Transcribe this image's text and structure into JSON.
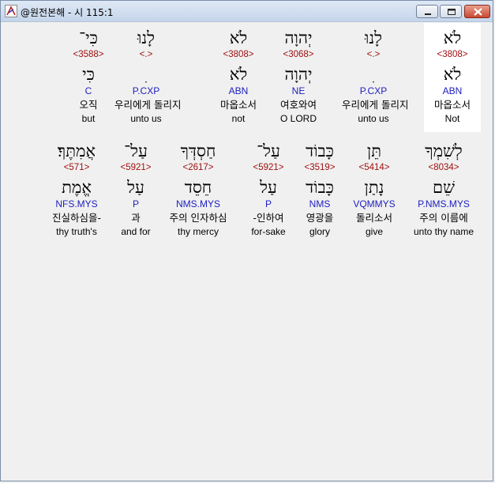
{
  "window": {
    "title": "@원전본해 - 시 115:1"
  },
  "row1": [
    {
      "heb": "לֹא",
      "strong": "<3808>",
      "heb_root": "לֹא",
      "morph": "ABN",
      "kor": "마옵소서",
      "eng": "Not",
      "highlight": true
    },
    {
      "heb": "לָנוּ",
      "strong": "<.>",
      "heb_root": "ִ",
      "morph": "P.CXP",
      "kor": "우리에게 돌리지",
      "eng": "unto us",
      "highlight": false
    },
    {
      "heb": "יְהוָה",
      "strong": "<3068>",
      "heb_root": "יְהוָה",
      "morph": "NE",
      "kor": "여호와여",
      "eng": "O LORD",
      "highlight": false
    },
    {
      "heb": "לֹא",
      "strong": "<3808>",
      "heb_root": "לֹא",
      "morph": "ABN",
      "kor": "마옵소서",
      "eng": "not",
      "highlight": false
    },
    {
      "heb": "לָנוּ",
      "strong": "<.>",
      "heb_root": "ִ",
      "morph": "P.CXP",
      "kor": "우리에게 돌리지",
      "eng": "unto us",
      "highlight": false
    },
    {
      "heb": "כִּי־",
      "strong": "<3588>",
      "heb_root": "כִּי",
      "morph": "C",
      "kor": "오직",
      "eng": "but",
      "highlight": false
    }
  ],
  "row2": [
    {
      "heb": "לְשִׁמְךָ",
      "strong": "<8034>",
      "heb_root": "שֵׁם",
      "morph": "P.NMS.MYS",
      "kor": "주의 이름에",
      "eng": "unto thy name"
    },
    {
      "heb": "תֵּן",
      "strong": "<5414>",
      "heb_root": "נָתַן",
      "morph": "VQMMYS",
      "kor": "돌리소서",
      "eng": "give"
    },
    {
      "heb": "כָּבוֹד",
      "strong": "<3519>",
      "heb_root": "כָּבוֹד",
      "morph": "NMS",
      "kor": "영광을",
      "eng": "glory"
    },
    {
      "heb": "עַל־",
      "strong": "<5921>",
      "heb_root": "עַל",
      "morph": "P",
      "kor": "-인하여",
      "eng": "for-sake"
    },
    {
      "heb": "חַסְדְּךָ",
      "strong": "<2617>",
      "heb_root": "חֵסֵד",
      "morph": "NMS.MYS",
      "kor": "주의 인자하심",
      "eng": "thy mercy"
    },
    {
      "heb": "עַל־",
      "strong": "<5921>",
      "heb_root": "עַל",
      "morph": "P",
      "kor": "과",
      "eng": "and for"
    },
    {
      "heb": "אֲמִתֶּךָ׃",
      "strong": "<571>",
      "heb_root": "אֱמֶת",
      "morph": "NFS.MYS",
      "kor": "진실하심을-",
      "eng": "thy truth's"
    }
  ]
}
